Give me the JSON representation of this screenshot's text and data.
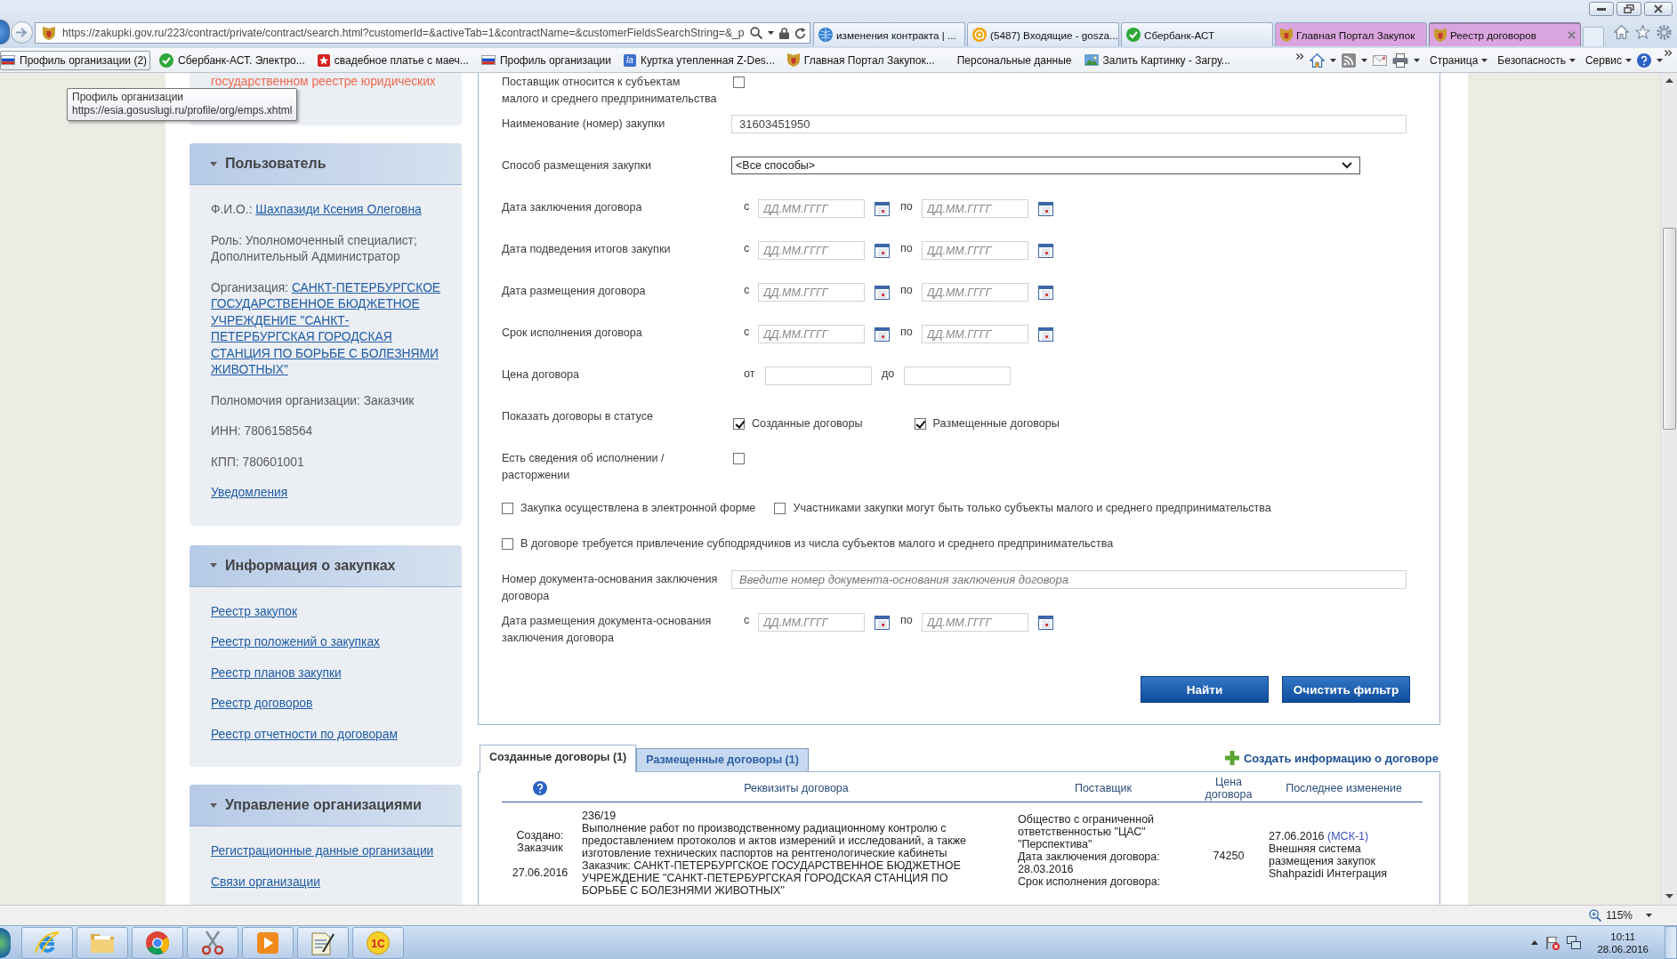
{
  "browser": {
    "address": "https://zakupki.gov.ru/223/contract/private/contract/search.html?customerId=&activeTab=1&contractName=&customerFieldsSearchString=&_p",
    "tabs": [
      {
        "label": "изменения контракта | ...",
        "selected": false
      },
      {
        "label": "(5487) Входящие - gosza...",
        "selected": false
      },
      {
        "label": "Сбербанк-АСТ",
        "selected": false
      },
      {
        "label": "Главная Портал Закупок",
        "selected": false,
        "color": "#daa4de"
      },
      {
        "label": "Реестр договоров",
        "selected": true,
        "color": "#daa4de"
      }
    ],
    "favorites": [
      {
        "label": "Профиль организации (2)",
        "hovered": true
      },
      {
        "label": "Сбербанк-АСТ. Электро...",
        "hovered": false
      },
      {
        "label": "свадебное платье с маеч...",
        "hovered": false
      },
      {
        "label": "Профиль организации",
        "hovered": false
      },
      {
        "label": "Куртка утепленная Z-Des...",
        "hovered": false,
        "logo_text": "la"
      },
      {
        "label": "Главная Портал Закупок...",
        "hovered": false
      },
      {
        "label": "Персональные данные",
        "hovered": false
      },
      {
        "label": "Залить Картинку - Загру...",
        "hovered": false
      }
    ],
    "menus": [
      "Страница",
      "Безопасность",
      "Сервис"
    ],
    "tooltip": {
      "title": "Профиль организации",
      "url": "https://esia.gosuslugi.ru/profile/org/emps.xhtml"
    }
  },
  "sidebar": {
    "notice": "государственном реестре юридических",
    "panels": [
      {
        "title": "Пользователь",
        "expanded": true,
        "items": [
          {
            "kind": "link_field",
            "label": "Ф.И.О.:",
            "value": "Шахпазиди Ксения Олеговна"
          },
          {
            "kind": "text",
            "text": "Роль: Уполномоченный специалист; Дополнительный Администратор"
          },
          {
            "kind": "link_field",
            "label": "Организация:",
            "value": "САНКТ-ПЕТЕРБУРГСКОЕ ГОСУДАРСТВЕННОЕ БЮДЖЕТНОЕ УЧРЕЖДЕНИЕ \"САНКТ-ПЕТЕРБУРГСКАЯ ГОРОДСКАЯ СТАНЦИЯ ПО БОРЬБЕ С БОЛЕЗНЯМИ ЖИВОТНЫХ\""
          },
          {
            "kind": "text",
            "text": "Полномочия организации: Заказчик"
          },
          {
            "kind": "text",
            "text": "ИНН: 7806158564"
          },
          {
            "kind": "text",
            "text": "КПП: 780601001"
          },
          {
            "kind": "link",
            "text": "Уведомления"
          }
        ]
      },
      {
        "title": "Информация о закупках",
        "expanded": true,
        "items": [
          {
            "kind": "link",
            "text": "Реестр закупок"
          },
          {
            "kind": "link",
            "text": "Реестр положений о закупках"
          },
          {
            "kind": "link",
            "text": "Реестр планов закупки"
          },
          {
            "kind": "link",
            "text": "Реестр договоров"
          },
          {
            "kind": "link",
            "text": "Реестр отчетности по договорам"
          }
        ]
      },
      {
        "title": "Управление организациями",
        "expanded": true,
        "items": [
          {
            "kind": "link",
            "text": "Регистрационные данные организации"
          },
          {
            "kind": "link",
            "text": "Связи организации"
          }
        ]
      }
    ]
  },
  "filter": {
    "rows": [
      {
        "kind": "checkbox",
        "label": "Поставщик относится к субъектам малого и среднего предпринимательства",
        "checked": false
      },
      {
        "kind": "text",
        "label": "Наименование (номер) закупки",
        "value": "31603451950"
      },
      {
        "kind": "select",
        "label": "Способ размещения закупки",
        "value": "<Все способы>"
      },
      {
        "kind": "date_range",
        "label": "Дата заключения договора",
        "from": "с",
        "to": "по",
        "from_placeholder": "ДД.ММ.ГГГГ",
        "to_placeholder": "ДД.ММ.ГГГГ"
      },
      {
        "kind": "date_range",
        "label": "Дата подведения итогов закупки",
        "from": "с",
        "to": "по",
        "from_placeholder": "ДД.ММ.ГГГГ",
        "to_placeholder": "ДД.ММ.ГГГГ"
      },
      {
        "kind": "date_range",
        "label": "Дата размещения договора",
        "from": "с",
        "to": "по",
        "from_placeholder": "ДД.ММ.ГГГГ",
        "to_placeholder": "ДД.ММ.ГГГГ"
      },
      {
        "kind": "date_range",
        "label": "Срок исполнения договора",
        "from": "с",
        "to": "по",
        "from_placeholder": "ДД.ММ.ГГГГ",
        "to_placeholder": "ДД.ММ.ГГГГ"
      },
      {
        "kind": "price_range",
        "label": "Цена договора",
        "from": "от",
        "to": "до"
      },
      {
        "kind": "statuses",
        "label": "Показать договоры в статусе",
        "options": [
          {
            "label": "Созданные договоры",
            "checked": true
          },
          {
            "label": "Размещенные договоры",
            "checked": true
          }
        ]
      },
      {
        "kind": "checkbox",
        "label": "Есть сведения об исполнении / расторжении",
        "checked": false
      },
      {
        "kind": "checks",
        "options": [
          {
            "label": "Закупка осуществлена в электронной форме",
            "checked": false
          },
          {
            "label": "Участниками закупки могут быть только субъекты малого и среднего предпринимательства",
            "checked": false
          }
        ]
      },
      {
        "kind": "checks",
        "options": [
          {
            "label": "В договоре требуется привлечение субподрядчиков из числа субъектов малого и среднего предпринимательства",
            "checked": false
          }
        ]
      },
      {
        "kind": "text",
        "label": "Номер документа-основания заключения договора",
        "placeholder": "Введите номер документа-основания заключения договора"
      },
      {
        "kind": "date_range",
        "label": "Дата размещения документа-основания заключения договора",
        "from": "с",
        "to": "по",
        "from_placeholder": "ДД.ММ.ГГГГ",
        "to_placeholder": "ДД.ММ.ГГГГ"
      }
    ],
    "buttons": [
      "Найти",
      "Очистить фильтр"
    ]
  },
  "results": {
    "tabs": [
      {
        "label": "Созданные договоры (1)",
        "selected": true
      },
      {
        "label": "Размещенные договоры (1)",
        "selected": false
      }
    ],
    "create_link": "Создать информацию о договоре",
    "columns": [
      "Реквизиты договора",
      "Поставщик",
      "Цена договора",
      "Последнее изменение"
    ],
    "rows": [
      {
        "created_by": "Создано: Заказчик",
        "created_date": "27.06.2016",
        "number": "236/19",
        "subject": "Выполнение работ по производственному радиационному контролю с предоставлением протоколов и актов измерений и исследований, а также изготовление технических паспортов на рентгенологические кабинеты",
        "customer": "Заказчик: САНКТ-ПЕТЕРБУРГСКОЕ ГОСУДАРСТВЕННОЕ БЮДЖЕТНОЕ УЧРЕЖДЕНИЕ \"САНКТ-ПЕТЕРБУРГСКАЯ ГОРОДСКАЯ СТАНЦИЯ ПО БОРЬБЕ С БОЛЕЗНЯМИ ЖИВОТНЫХ\"",
        "supplier": "Общество с ограниченной ответственностью \"ЦАС\" \"Перспектива\"",
        "signed_label": "Дата заключения договора:",
        "signed_date": "28.03.2016",
        "term_label": "Срок исполнения договора:",
        "price": "74250",
        "changed_date": "27.06.2016",
        "timezone": "(МСК-1)",
        "source": "Внешняя система размещения закупок",
        "user": "Shahpazidi Интеграция"
      }
    ]
  },
  "status_bar": {
    "zoom": "115%"
  },
  "taskbar": {
    "app_logo_text": "1С",
    "time": "10:11",
    "date": "28.06.2016"
  }
}
